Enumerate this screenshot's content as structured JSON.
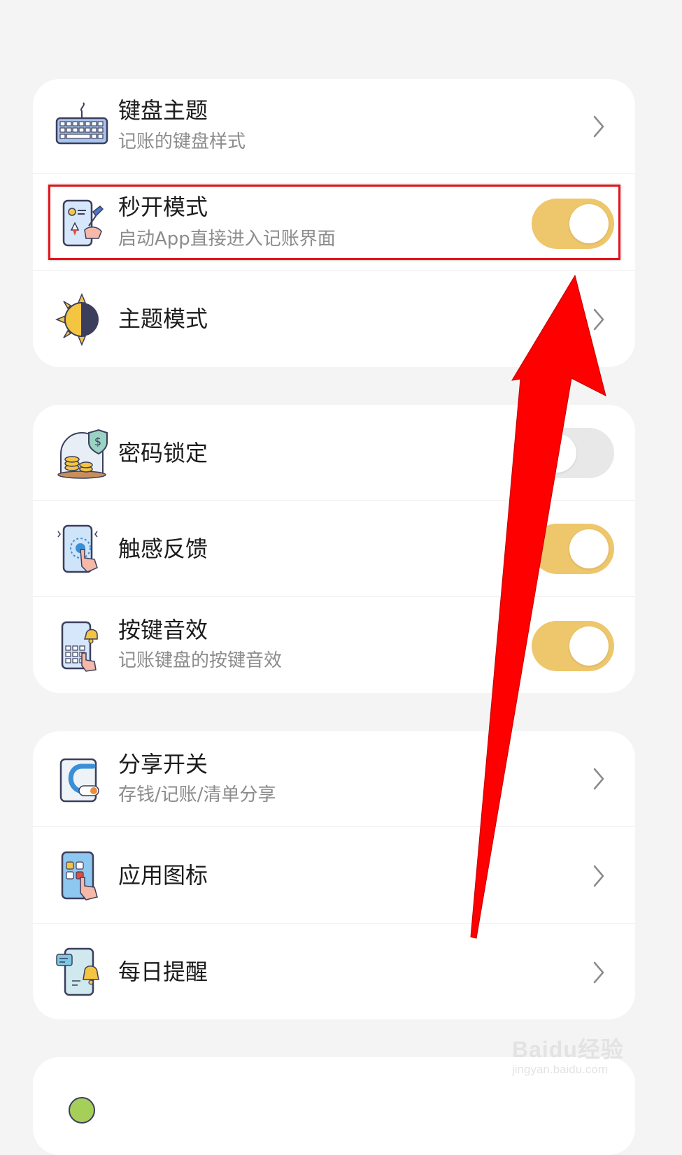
{
  "accent_color": "#eec66b",
  "annotation_color": "#e5141b",
  "sections": [
    {
      "items": [
        {
          "title": "键盘主题",
          "subtitle": "记账的键盘样式",
          "icon": "keyboard-icon",
          "control": "chevron"
        },
        {
          "title": "秒开模式",
          "subtitle": "启动App直接进入记账界面",
          "icon": "quick-launch-icon",
          "control": "toggle",
          "toggle_on": true
        },
        {
          "title": "主题模式",
          "icon": "day-night-icon",
          "control": "chevron"
        }
      ]
    },
    {
      "items": [
        {
          "title": "密码锁定",
          "icon": "password-lock-icon",
          "control": "toggle",
          "toggle_on": false
        },
        {
          "title": "触感反馈",
          "icon": "haptic-feedback-icon",
          "control": "toggle",
          "toggle_on": true
        },
        {
          "title": "按键音效",
          "subtitle": "记账键盘的按键音效",
          "icon": "key-sound-icon",
          "control": "toggle",
          "toggle_on": true
        }
      ]
    },
    {
      "items": [
        {
          "title": "分享开关",
          "subtitle": "存钱/记账/清单分享",
          "icon": "share-icon",
          "control": "chevron"
        },
        {
          "title": "应用图标",
          "icon": "app-icon-icon",
          "control": "chevron"
        },
        {
          "title": "每日提醒",
          "icon": "daily-reminder-icon",
          "control": "chevron"
        }
      ]
    }
  ],
  "watermark": {
    "brand": "Baidu经验",
    "url": "jingyan.baidu.com"
  }
}
